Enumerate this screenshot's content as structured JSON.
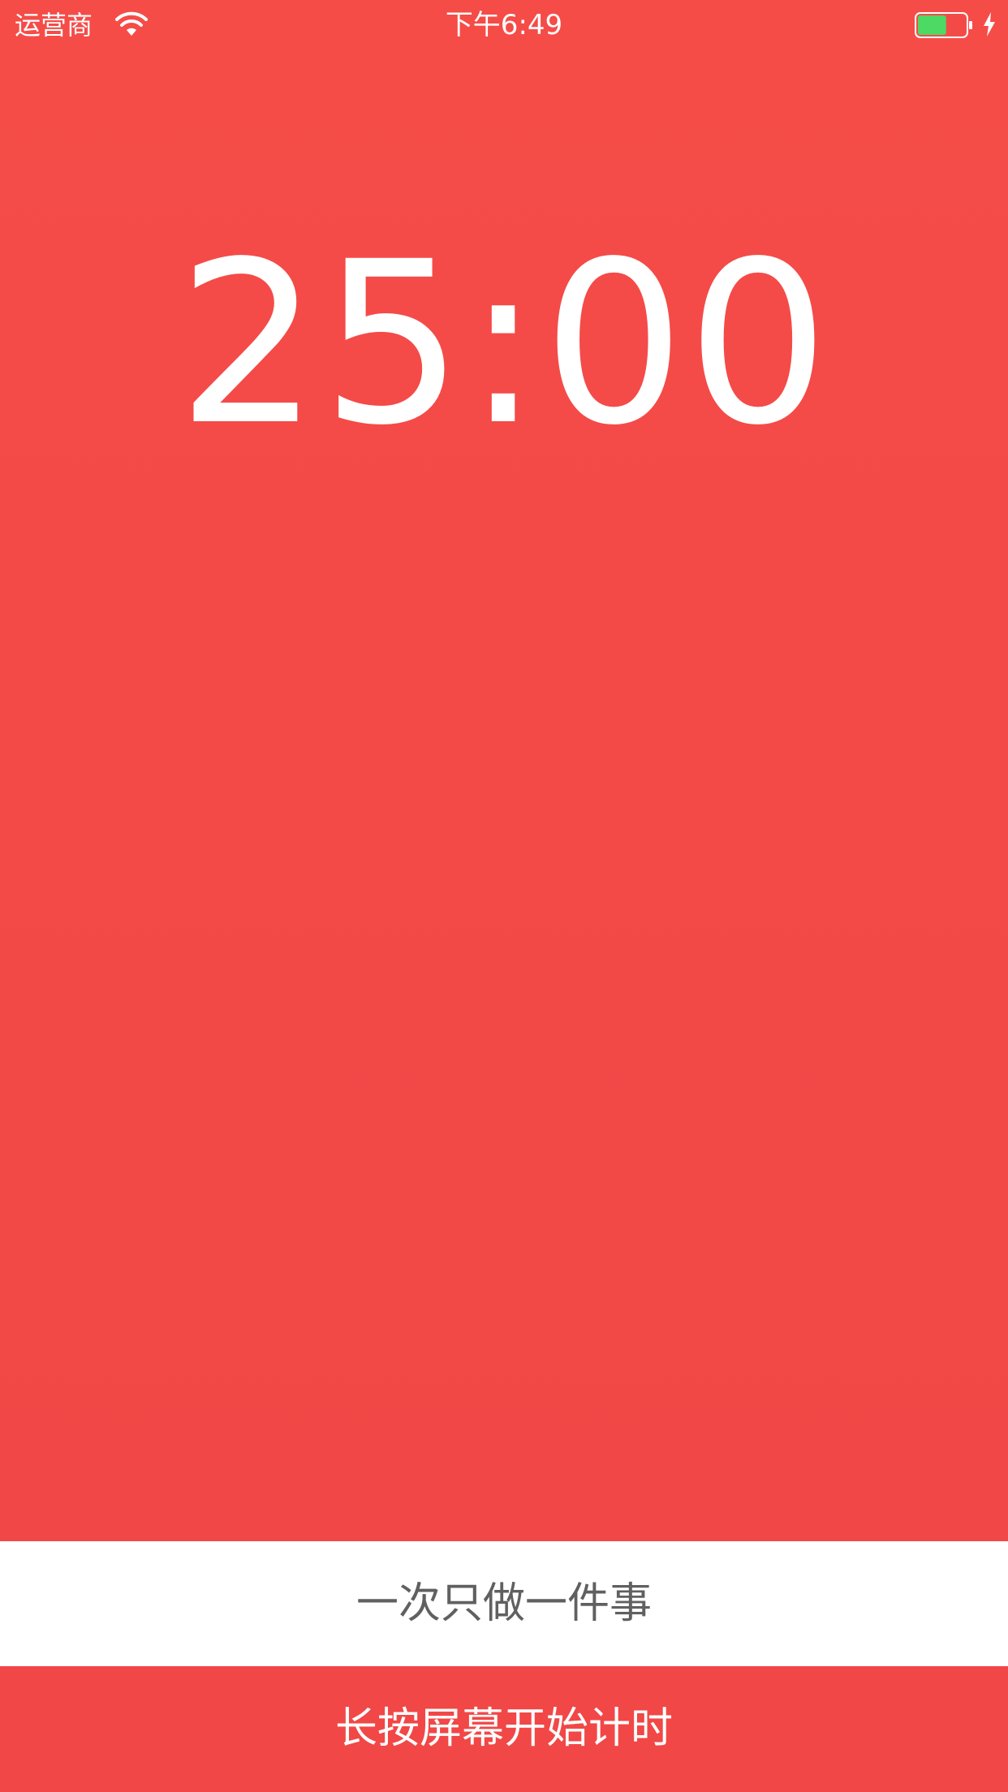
{
  "status_bar": {
    "carrier": "运营商",
    "time": "下午6:49",
    "battery_level": 0.6,
    "charging": true,
    "icons": [
      "wifi-icon",
      "battery-icon",
      "charging-bolt-icon"
    ]
  },
  "timer": {
    "display": "25:00"
  },
  "motto": {
    "text": "一次只做一件事"
  },
  "hint": {
    "text": "长按屏幕开始计时"
  },
  "colors": {
    "background": "#f34a47",
    "motto_band": "#ffffff",
    "motto_text": "#606060",
    "battery_fill_green": "#4cd964",
    "battery_fill_red": "#f34a47"
  }
}
